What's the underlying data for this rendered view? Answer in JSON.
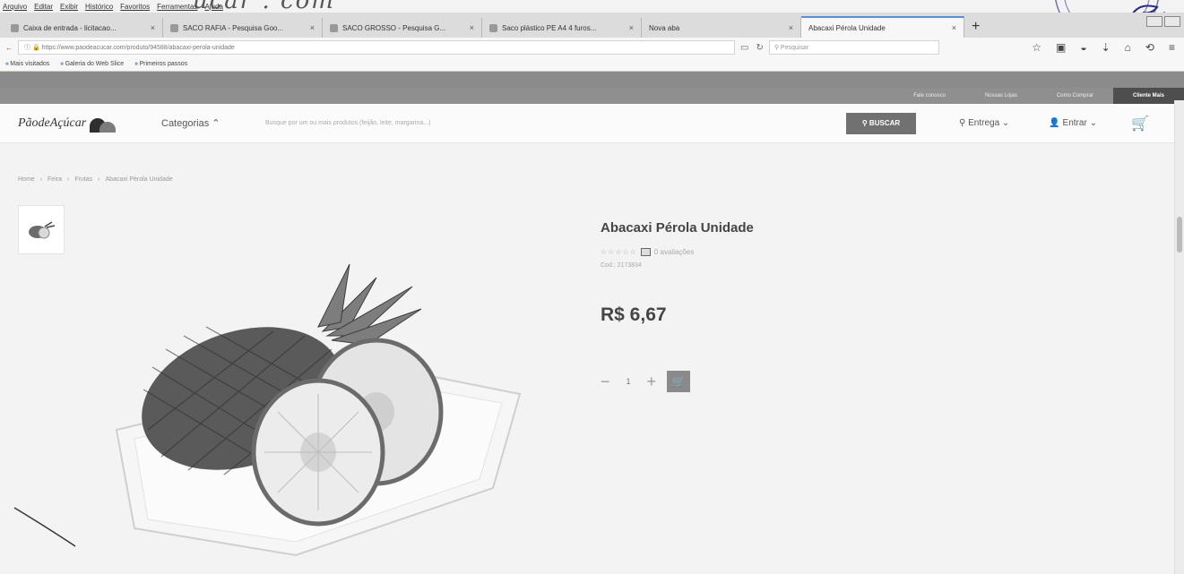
{
  "browser": {
    "menu": [
      "Arquivo",
      "Editar",
      "Exibir",
      "Histórico",
      "Favoritos",
      "Ferramentas",
      "Ajuda"
    ],
    "tabs": [
      {
        "label": "Caixa de entrada - licitacao..."
      },
      {
        "label": "SACO RAFIA - Pesquisa Goo..."
      },
      {
        "label": "SACO GROSSO - Pesquisa G..."
      },
      {
        "label": "Saco plástico PE A4 4 furos..."
      },
      {
        "label": "Nova aba"
      },
      {
        "label": "Abacaxi Pérola Unidade"
      }
    ],
    "url": "https://www.paodeacucar.com/produto/94588/abacaxi-perola-unidade",
    "search_placeholder": "Pesquisar",
    "bookmarks": [
      "Mais visitados",
      "Galeria do Web Slice",
      "Primeiros passos"
    ]
  },
  "site": {
    "top_links": [
      "Fale conosco",
      "Nossas Lojas",
      "Como Comprar",
      "Cliente Mais"
    ],
    "logo": "PãodeAçúcar",
    "categorias": "Categorias ⌃",
    "search_placeholder": "Busque por um ou mais produtos (feijão, leite, margarina...)",
    "buscar": "BUSCAR",
    "entrega": "Entrega",
    "entrar": "Entrar"
  },
  "breadcrumb": [
    "Home",
    "Feira",
    "Frutas",
    "Abacaxi Pérola Unidade"
  ],
  "product": {
    "name": "Abacaxi Pérola Unidade",
    "stars": "☆☆☆☆☆",
    "reviews": "0 avaliações",
    "code": "Cod.: 2173834",
    "price": "R$ 6,67",
    "quantity": "1"
  },
  "annotation": {
    "handwriting": "ucar . com"
  }
}
